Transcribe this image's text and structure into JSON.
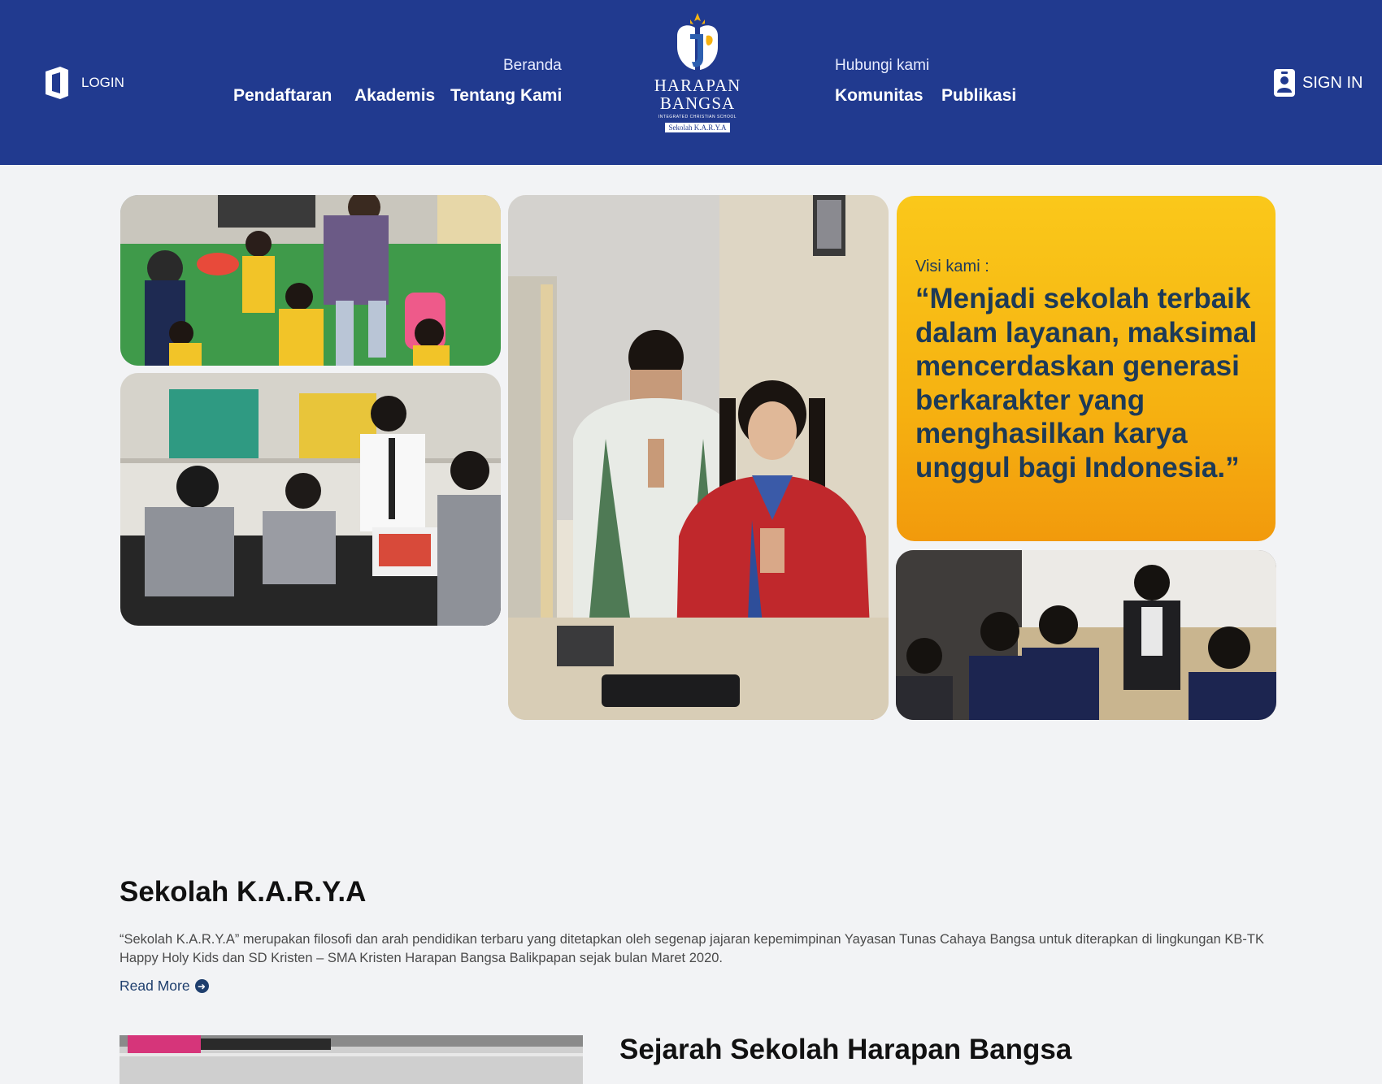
{
  "colors": {
    "header_bg": "#213a8f",
    "page_bg": "#f2f3f5",
    "vision_bg": "#f6b211",
    "vision_text": "#1d3a57"
  },
  "header": {
    "login_label": "LOGIN",
    "signin_label": "SIGN IN",
    "nav_top_left": "Beranda",
    "nav_top_right": "Hubungi kami",
    "nav_left": [
      "Pendaftaran",
      "Akademis",
      "Tentang Kami"
    ],
    "nav_right": [
      "Komunitas",
      "Publikasi"
    ],
    "logo": {
      "line1": "HARAPAN",
      "line2": "BANGSA",
      "subtitle": "INTEGRATED CHRISTIAN SCHOOL",
      "tag": "Sekolah K.A.R.Y.A"
    }
  },
  "hero": {
    "photos": [
      {
        "icon": "photo-kindergarten-playground"
      },
      {
        "icon": "photo-science-lab"
      },
      {
        "icon": "photo-students-greeting"
      },
      {
        "icon": "photo-classroom-discussion"
      }
    ],
    "vision_label": "Visi kami :",
    "vision_quote": "“Menjadi sekolah terbaik dalam layanan, maksimal mencerdaskan generasi berkarakter yang menghasilkan karya unggul bagi Indonesia.”"
  },
  "karya": {
    "title": "Sekolah K.A.R.Y.A",
    "description": "“Sekolah K.A.R.Y.A” merupakan filosofi dan arah pendidikan terbaru yang ditetapkan oleh segenap jajaran kepemimpinan Yayasan Tunas Cahaya Bangsa untuk diterapkan di lingkungan KB-TK Happy Holy Kids dan SD Kristen – SMA Kristen Harapan Bangsa Balikpapan sejak bulan Maret 2020.",
    "read_more": "Read More"
  },
  "sejarah": {
    "title": "Sejarah Sekolah Harapan Bangsa"
  }
}
